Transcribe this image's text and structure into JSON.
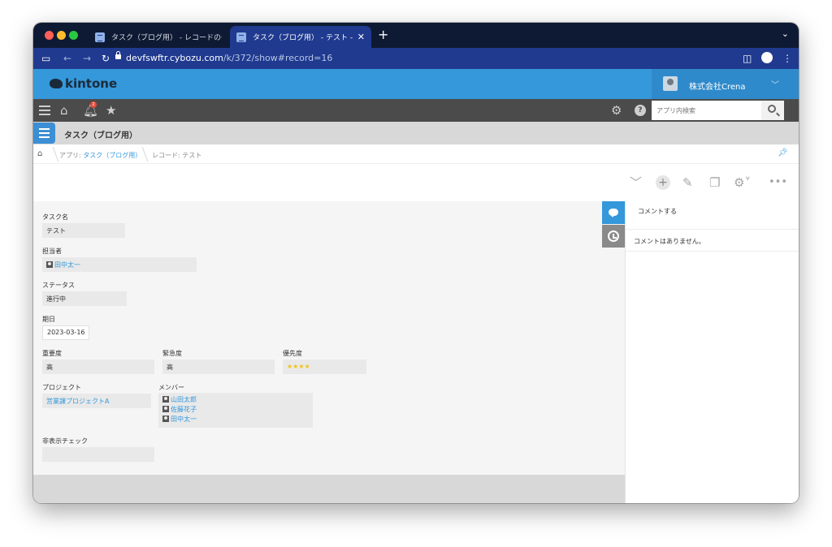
{
  "browser": {
    "tabs": [
      {
        "label": "タスク（ブログ用） - レコードの一覧",
        "active": false
      },
      {
        "label": "タスク（ブログ用） - テスト - レコードの詳細",
        "active": true
      }
    ],
    "url_host": "devfswftr.cybozu.com",
    "url_path": "/k/372/show#record=16"
  },
  "header": {
    "logo_text": "kintone",
    "company": "株式会社Crena"
  },
  "toolbar": {
    "notification_count": "2",
    "search_placeholder": "アプリ内検索",
    "help_label": "?"
  },
  "app": {
    "name": "タスク（ブログ用）"
  },
  "breadcrumb": {
    "app_prefix": "アプリ: ",
    "app_link": "タスク（ブログ用）",
    "record": "レコード: テスト"
  },
  "record": {
    "task_name": {
      "label": "タスク名",
      "value": "テスト"
    },
    "assignee": {
      "label": "担当者",
      "value": "田中太一"
    },
    "status": {
      "label": "ステータス",
      "value": "進行中"
    },
    "due_date": {
      "label": "期日",
      "value": "2023-03-16"
    },
    "importance": {
      "label": "重要度",
      "value": "高"
    },
    "urgency": {
      "label": "緊急度",
      "value": "高"
    },
    "priority": {
      "label": "優先度",
      "value": "★★★★"
    },
    "project": {
      "label": "プロジェクト",
      "value": "営業課プロジェクトA"
    },
    "members": {
      "label": "メンバー",
      "values": [
        "山田太郎",
        "佐藤花子",
        "田中太一"
      ]
    },
    "hidden_check": {
      "label": "非表示チェック",
      "value": ""
    }
  },
  "comments": {
    "input_placeholder": "コメントする",
    "empty_text": "コメントはありません。"
  },
  "colors": {
    "kintone_blue": "#3498db",
    "browser_chrome": "#1f3a8f",
    "toolbar_gray": "#4b4b4b"
  }
}
